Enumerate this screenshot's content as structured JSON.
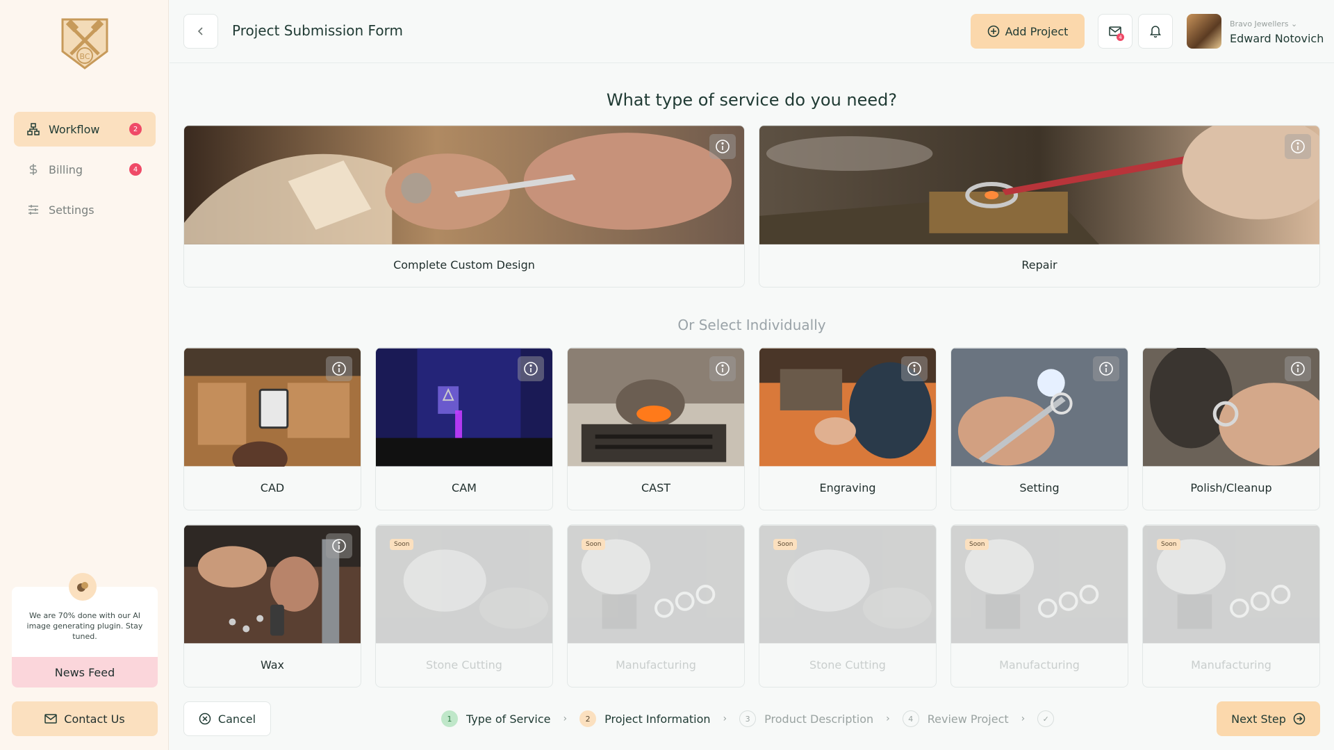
{
  "app": {
    "logo_text": "BC"
  },
  "sidebar": {
    "items": [
      {
        "label": "Workflow",
        "badge": "2",
        "icon": "workflow-icon"
      },
      {
        "label": "Billing",
        "badge": "4",
        "icon": "dollar-icon"
      },
      {
        "label": "Settings",
        "badge": "",
        "icon": "sliders-icon"
      }
    ],
    "news": {
      "text": "We are 70% done with our AI image generating plugin. Stay tuned.",
      "button": "News Feed"
    },
    "contact_label": "Contact Us"
  },
  "header": {
    "title": "Project Submission Form",
    "add_project_label": "Add Project",
    "mail_badge": "4",
    "user": {
      "company": "Bravo Jewellers",
      "name": "Edward Notovich"
    }
  },
  "main": {
    "question": "What type of service do you need?",
    "primary_services": [
      "Complete Custom Design",
      "Repair"
    ],
    "or_select": "Or Select Individually",
    "individual_services": [
      "CAD",
      "CAM",
      "CAST",
      "Engraving",
      "Setting",
      "Polish/Cleanup",
      "Wax"
    ],
    "soon_badge": "Soon",
    "coming_soon_services": [
      "Stone Cutting",
      "Manufacturing",
      "Stone Cutting",
      "Manufacturing",
      "Manufacturing"
    ]
  },
  "footer": {
    "cancel_label": "Cancel",
    "steps": [
      {
        "num": "1",
        "label": "Type of Service"
      },
      {
        "num": "2",
        "label": "Project Information"
      },
      {
        "num": "3",
        "label": "Product Description"
      },
      {
        "num": "4",
        "label": "Review Project"
      }
    ],
    "next_label": "Next Step"
  },
  "colors": {
    "accent": "#fbd8ac",
    "badge": "#ef4a67",
    "sidebar_bg": "#fdf6ef",
    "text_dark": "#1f3a33"
  }
}
